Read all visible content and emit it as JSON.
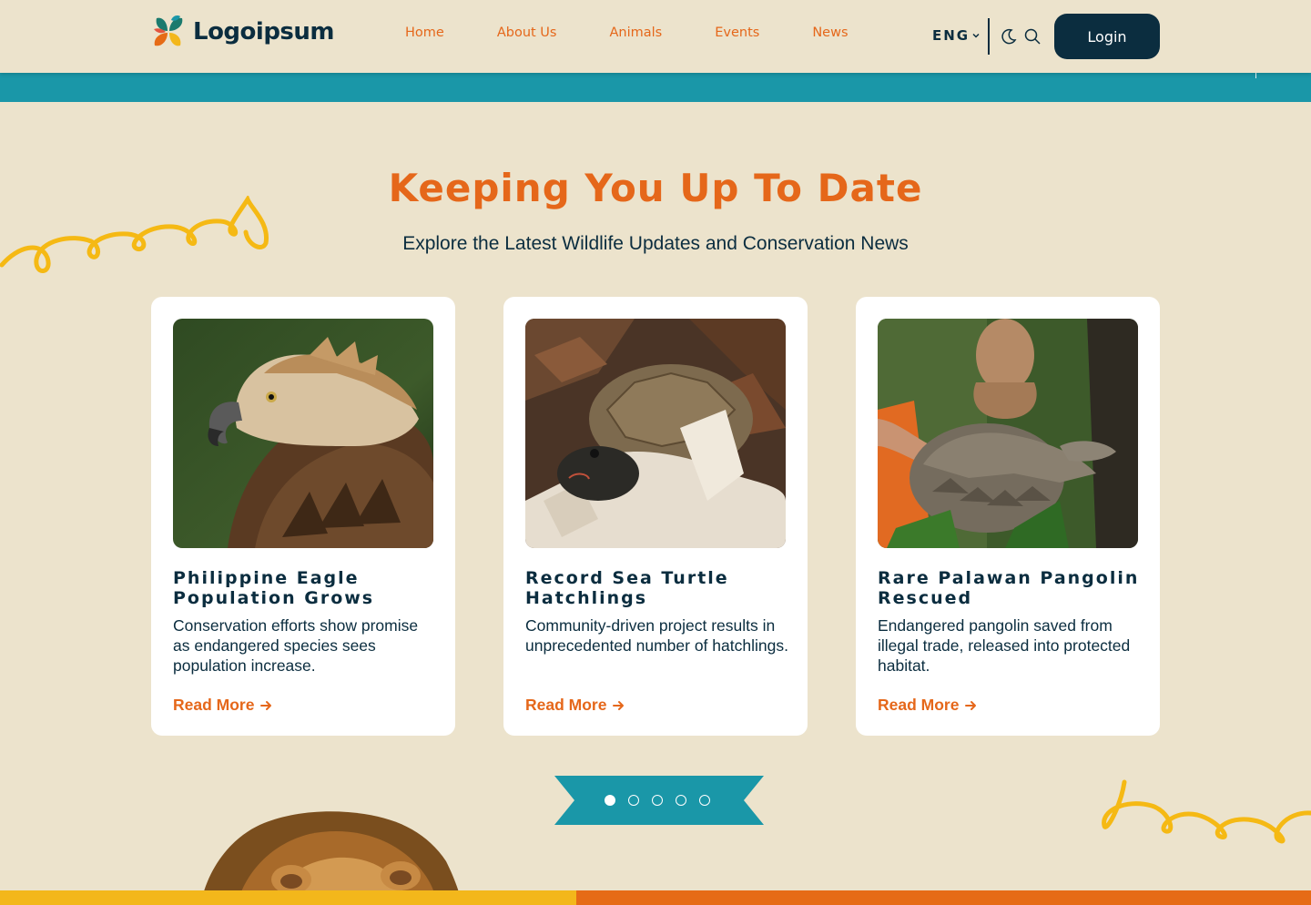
{
  "header": {
    "logo_text": "Logoipsum",
    "nav": [
      "Home",
      "About Us",
      "Animals",
      "Events",
      "News"
    ],
    "language": "ENG",
    "login_label": "Login"
  },
  "section": {
    "title": "Keeping You Up To Date",
    "subtitle": "Explore the Latest Wildlife Updates and Conservation News"
  },
  "cards": [
    {
      "title": "Philippine Eagle Population Grows",
      "description": "Conservation efforts show promise as endangered species sees population increase.",
      "link": "Read More"
    },
    {
      "title": "Record Sea Turtle Hatchlings",
      "description": "Community-driven project results in unprecedented number of hatchlings.",
      "link": "Read More"
    },
    {
      "title": "Rare Palawan Pangolin Rescued",
      "description": "Endangered pangolin saved from illegal trade, released into protected habitat.",
      "link": "Read More"
    }
  ],
  "pager": {
    "pages": 5,
    "active": 1
  },
  "colors": {
    "background": "#ece3cc",
    "accent": "#e5671a",
    "navy": "#0b2d3f",
    "teal": "#1a97a8",
    "yellow": "#f3b71b"
  }
}
